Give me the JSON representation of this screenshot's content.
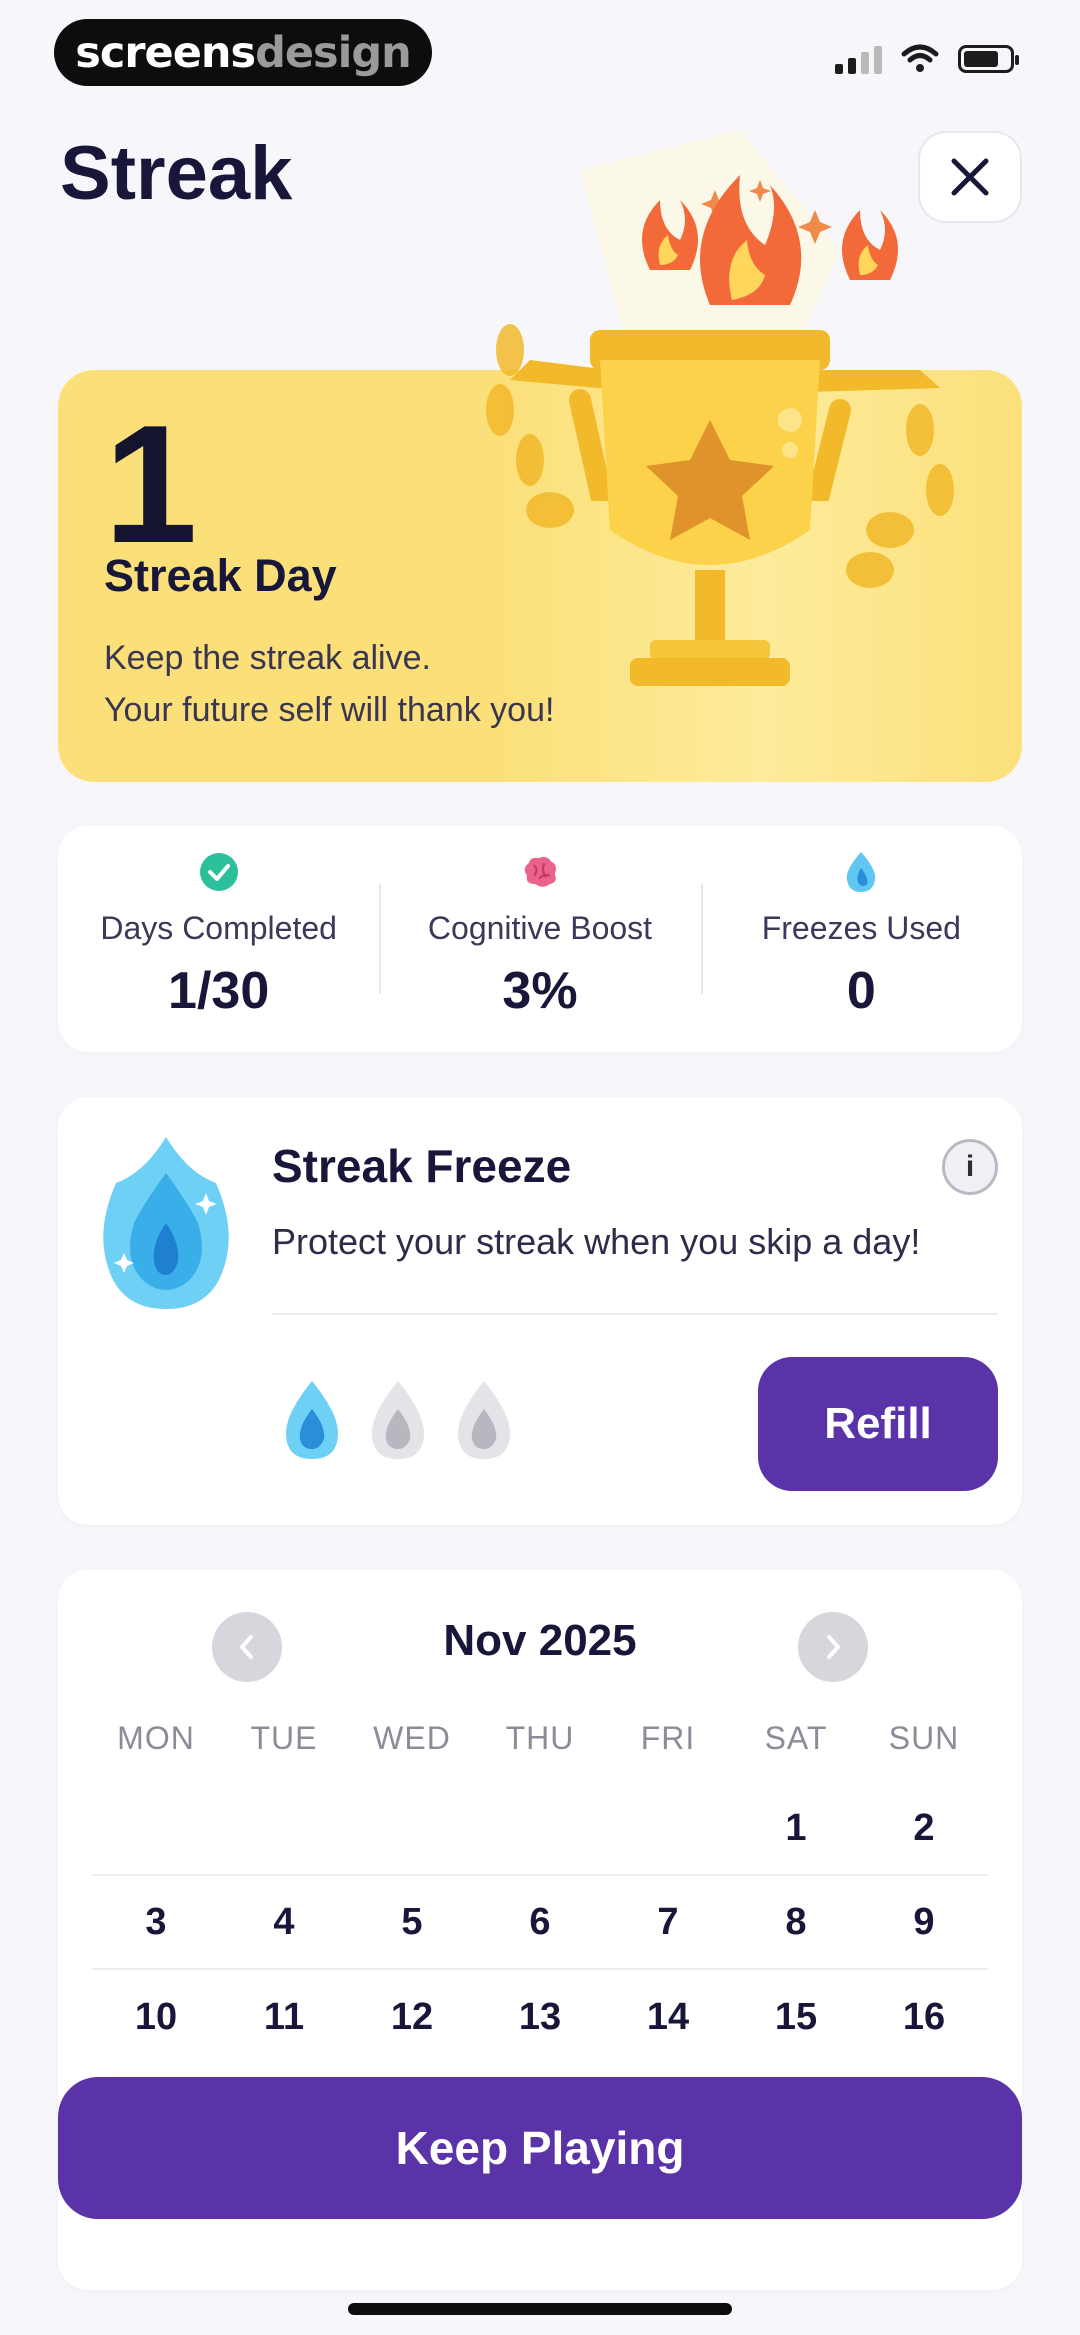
{
  "watermark": {
    "part1": "screens",
    "part2": "design"
  },
  "header": {
    "title": "Streak"
  },
  "hero": {
    "count": "1",
    "label": "Streak Day",
    "desc_line1": "Keep the streak alive.",
    "desc_line2": "Your future self will thank you!"
  },
  "stats": [
    {
      "icon": "check-icon",
      "label": "Days Completed",
      "value": "1/30"
    },
    {
      "icon": "brain-icon",
      "label": "Cognitive Boost",
      "value": "3%"
    },
    {
      "icon": "freeze-drop-icon",
      "label": "Freezes Used",
      "value": "0"
    }
  ],
  "freeze": {
    "title": "Streak Freeze",
    "desc": "Protect your streak when you skip a day!",
    "info_label": "i",
    "refill_label": "Refill",
    "available": 1,
    "total": 3
  },
  "calendar": {
    "month_label": "Nov 2025",
    "weekdays": [
      "MON",
      "TUE",
      "WED",
      "THU",
      "FRI",
      "SAT",
      "SUN"
    ],
    "weeks": [
      [
        "",
        "",
        "",
        "",
        "",
        "1",
        "2"
      ],
      [
        "3",
        "4",
        "5",
        "6",
        "7",
        "8",
        "9"
      ],
      [
        "10",
        "11",
        "12",
        "13",
        "14",
        "15",
        "16"
      ]
    ]
  },
  "cta": {
    "label": "Keep Playing"
  },
  "colors": {
    "accent": "#5b33a8",
    "hero": "#fbe07a",
    "check": "#2bbf9a"
  }
}
